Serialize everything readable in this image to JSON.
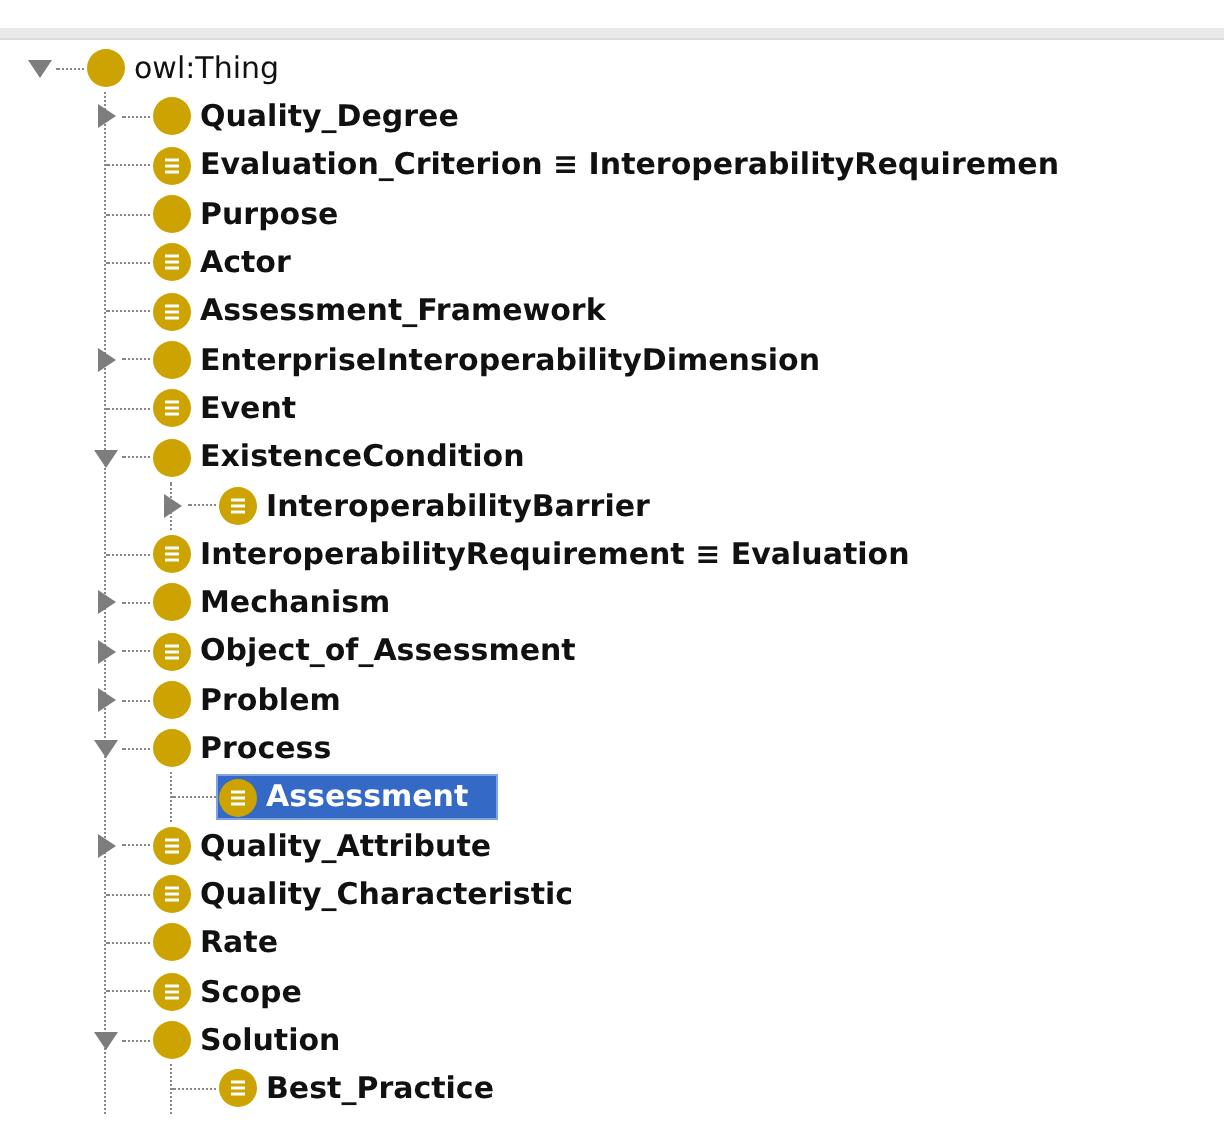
{
  "class_tree": [
    {
      "label": "owl:Thing",
      "kind": "primitive",
      "expanded": true,
      "selected": false,
      "children": [
        {
          "label": "Quality_Degree",
          "kind": "primitive",
          "expanded": false,
          "selected": false
        },
        {
          "label": "Evaluation_Criterion ≡ InteroperabilityRequiremen",
          "kind": "defined",
          "selected": false
        },
        {
          "label": "Purpose",
          "kind": "primitive",
          "selected": false
        },
        {
          "label": "Actor",
          "kind": "defined",
          "selected": false
        },
        {
          "label": "Assessment_Framework",
          "kind": "defined",
          "selected": false
        },
        {
          "label": "EnterpriseInteroperabilityDimension",
          "kind": "primitive",
          "expanded": false,
          "selected": false
        },
        {
          "label": "Event",
          "kind": "defined",
          "selected": false
        },
        {
          "label": "ExistenceCondition",
          "kind": "primitive",
          "expanded": true,
          "selected": false,
          "children": [
            {
              "label": "InteroperabilityBarrier",
              "kind": "defined",
              "expanded": false,
              "selected": false
            }
          ]
        },
        {
          "label": "InteroperabilityRequirement ≡ Evaluation",
          "kind": "defined",
          "selected": false
        },
        {
          "label": "Mechanism",
          "kind": "primitive",
          "expanded": false,
          "selected": false
        },
        {
          "label": "Object_of_Assessment",
          "kind": "defined",
          "expanded": false,
          "selected": false
        },
        {
          "label": "Problem",
          "kind": "primitive",
          "expanded": false,
          "selected": false
        },
        {
          "label": "Process",
          "kind": "primitive",
          "expanded": true,
          "selected": false,
          "children": [
            {
              "label": "Assessment",
              "kind": "defined",
              "selected": true
            }
          ]
        },
        {
          "label": "Quality_Attribute",
          "kind": "defined",
          "expanded": false,
          "selected": false
        },
        {
          "label": "Quality_Characteristic",
          "kind": "defined",
          "selected": false
        },
        {
          "label": "Rate",
          "kind": "primitive",
          "selected": false
        },
        {
          "label": "Scope",
          "kind": "defined",
          "selected": false
        },
        {
          "label": "Solution",
          "kind": "primitive",
          "expanded": true,
          "selected": false,
          "children": [
            {
              "label": "Best_Practice",
              "kind": "defined",
              "selected": false
            }
          ]
        }
      ]
    }
  ]
}
